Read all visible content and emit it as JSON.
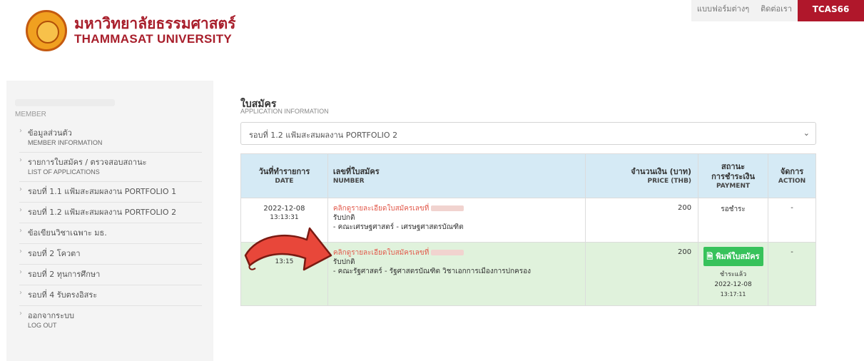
{
  "header": {
    "logo_th": "มหาวิทยาลัยธรรมศาสตร์",
    "logo_en": "THAMMASAT UNIVERSITY",
    "nav": [
      {
        "label": "แบบฟอร์มต่างๆ"
      },
      {
        "label": "ติดต่อเรา"
      }
    ],
    "tcas": "TCAS66"
  },
  "sidebar": {
    "member_label": "MEMBER",
    "items": [
      {
        "th": "ข้อมูลส่วนตัว",
        "en": "MEMBER INFORMATION"
      },
      {
        "th": "รายการใบสมัคร / ตรวจสอบสถานะ",
        "en": "LIST OF APPLICATIONS"
      },
      {
        "th": "รอบที่ 1.1 แฟ้มสะสมผลงาน PORTFOLIO 1",
        "en": ""
      },
      {
        "th": "รอบที่ 1.2 แฟ้มสะสมผลงาน PORTFOLIO 2",
        "en": ""
      },
      {
        "th": "ข้อเขียนวิชาเฉพาะ มธ.",
        "en": ""
      },
      {
        "th": "รอบที่ 2 โควตา",
        "en": ""
      },
      {
        "th": "รอบที่ 2 ทุนการศึกษา",
        "en": ""
      },
      {
        "th": "รอบที่ 4 รับตรงอิสระ",
        "en": ""
      },
      {
        "th": "ออกจากระบบ",
        "en": "LOG OUT"
      }
    ]
  },
  "main": {
    "title": "ใบสมัคร",
    "subtitle": "APPLICATION INFORMATION",
    "round_select": "รอบที่ 1.2 แฟ้มสะสมผลงาน PORTFOLIO 2",
    "table": {
      "headers": [
        {
          "th": "วันที่ทำรายการ",
          "en": "DATE"
        },
        {
          "th": "เลขที่ใบสมัคร",
          "en": "NUMBER"
        },
        {
          "th": "จำนวนเงิน (บาท)",
          "en": "PRICE (THB)"
        },
        {
          "th1": "สถานะ",
          "th2": "การชำระเงิน",
          "en": "PAYMENT"
        },
        {
          "th": "จัดการ",
          "en": "ACTION"
        }
      ],
      "rows": [
        {
          "date": "2022-12-08",
          "time": "13:13:31",
          "link": "คลิกดูรายละเอียดใบสมัครเลขที่",
          "program": "รับปกติ",
          "faculty": "- คณะเศรษฐศาสตร์ - เศรษฐศาสตรบัณฑิต",
          "price": "200",
          "payment": "รอชำระ",
          "action": "-"
        },
        {
          "date": "2022-12",
          "time": "13:15",
          "link": "คลิกดูรายละเอียดใบสมัครเลขที่",
          "program": "รับปกติ",
          "faculty": "- คณะรัฐศาสตร์ - รัฐศาสตรบัณฑิต วิชาเอกการเมืองการปกครอง",
          "price": "200",
          "print_button": "พิมพ์ใบสมัคร",
          "payment": "ชำระแล้ว",
          "paid_date": "2022-12-08",
          "paid_time": "13:17:11",
          "action": "-"
        }
      ]
    }
  },
  "colors": {
    "brand": "#a81e2b",
    "tcas_bg": "#b0172b",
    "table_head": "#d5eaf5",
    "paid_row": "#e0f2dc",
    "print_button": "#37c25b",
    "link": "#e25a4c",
    "arrow": "#e8473a"
  }
}
